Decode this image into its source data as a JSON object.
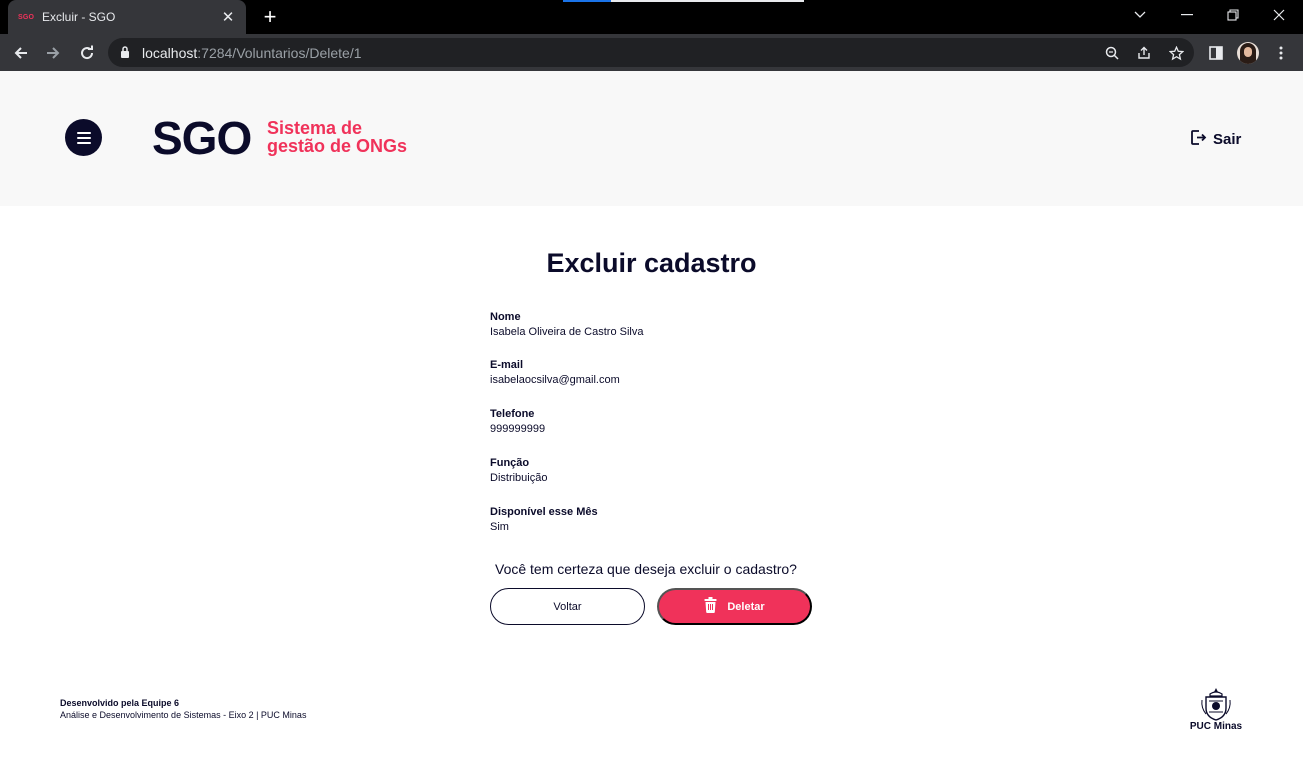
{
  "browser": {
    "tab_favicon": "SGO",
    "tab_title": "Excluir - SGO",
    "url_host": "localhost",
    "url_path": ":7284/Voluntarios/Delete/1"
  },
  "header": {
    "logo": "SGO",
    "subtitle_line1": "Sistema de",
    "subtitle_line2": "gestão de ONGs",
    "logout_label": "Sair"
  },
  "main": {
    "title": "Excluir cadastro",
    "fields": [
      {
        "label": "Nome",
        "value": "Isabela Oliveira de Castro Silva"
      },
      {
        "label": "E-mail",
        "value": "isabelaocsilva@gmail.com"
      },
      {
        "label": "Telefone",
        "value": "999999999"
      },
      {
        "label": "Função",
        "value": "Distribuição"
      },
      {
        "label": "Disponível esse Mês",
        "value": "Sim"
      }
    ],
    "confirm_text": "Você tem certeza que deseja excluir o cadastro?",
    "back_label": "Voltar",
    "delete_label": "Deletar"
  },
  "footer": {
    "team": "Desenvolvido pela Equipe 6",
    "course": "Análise e Desenvolvimento de Sistemas - Eixo 2 | PUC Minas",
    "puc_label": "PUC Minas"
  },
  "colors": {
    "accent": "#f0325a",
    "dark": "#0b0b2a",
    "header_bg": "#f8f8f8"
  }
}
